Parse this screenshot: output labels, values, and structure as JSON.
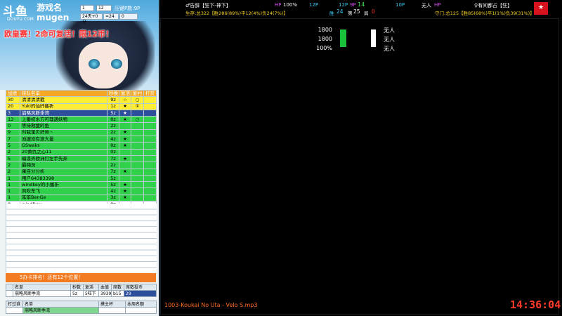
{
  "left_panel": {
    "logo": "斗鱼",
    "logo_sub": "DOUYU.COM",
    "game_name": "游戏名",
    "game_name_en": "mugen",
    "selects": [
      "1",
      "12"
    ],
    "controls_label": "压键P数:9P",
    "mini_fields": [
      "24天+0分",
      "=24",
      "0"
    ],
    "promo": "欧皇赛！2命可复活！限12币！",
    "table_headers": [
      "战绩",
      "排队名单",
      "秒换",
      "复活",
      "复约",
      "打赏"
    ],
    "rows": [
      {
        "c": [
          "30",
          "清清清清戳",
          "9z",
          "☆",
          "○",
          ""
        ],
        "style": "yellow"
      },
      {
        "c": [
          "20",
          "Yuki的灿奸播祈",
          "1z",
          "★",
          "①",
          ""
        ],
        "style": "yellow"
      },
      {
        "c": [
          "3",
          "崩略风断季湾",
          "5z",
          "★",
          "",
          ""
        ],
        "style": "blue"
      },
      {
        "c": [
          "13",
          "上番初水方可理遇妖物",
          "0z",
          "★",
          "○",
          ""
        ],
        "style": "green"
      },
      {
        "c": [
          "0",
          "等待救援的鱼",
          "2z",
          "",
          "",
          ""
        ],
        "style": "green"
      },
      {
        "c": [
          "9",
          "时我宝贝好帅丶",
          "2z",
          "★",
          "",
          ""
        ],
        "style": "green"
      },
      {
        "c": [
          "7",
          "池塘没有滚大量",
          "4z",
          "★",
          "",
          ""
        ],
        "style": "green"
      },
      {
        "c": [
          "5",
          "GSwaks",
          "0z",
          "★",
          "",
          ""
        ],
        "style": "green"
      },
      {
        "c": [
          "2",
          "20黄仇之心11",
          "0z",
          "",
          "",
          ""
        ],
        "style": "green"
      },
      {
        "c": [
          "5",
          "编谍弄欧洲打左手先弃",
          "7z",
          "★",
          "",
          ""
        ],
        "style": "green"
      },
      {
        "c": [
          "2",
          "最嗨员",
          "2z",
          "",
          "",
          ""
        ],
        "style": "green"
      },
      {
        "c": [
          "2",
          "果自分分析",
          "7z",
          "★",
          "",
          ""
        ],
        "style": "green"
      },
      {
        "c": [
          "1",
          "用户64383398",
          "5z",
          "",
          "",
          ""
        ],
        "style": "green"
      },
      {
        "c": [
          "1",
          "windkey的小播祈",
          "5z",
          "★",
          "",
          ""
        ],
        "style": "green"
      },
      {
        "c": [
          "1",
          "风吹东飞",
          "4z",
          "★",
          "",
          ""
        ],
        "style": "green"
      },
      {
        "c": [
          "1",
          "笨笨BenGe",
          "3z",
          "★",
          "",
          ""
        ],
        "style": "green"
      },
      {
        "c": [
          "0",
          "windlkey",
          "8z",
          "",
          "",
          ""
        ],
        "style": "white"
      },
      {
        "c": [
          "0",
          "铁血骑冥",
          "3z",
          "",
          "①",
          ""
        ],
        "style": "white"
      }
    ],
    "orange_bar": "5办卡排名！还有12个位置！",
    "info_headers": [
      "名单",
      "秒数",
      "复活",
      "血值",
      "席数",
      "席数投币"
    ],
    "info_values": [
      "崩略风断季湾",
      "5z",
      "5旺下",
      "3939",
      "b15",
      "29"
    ],
    "footer_headers": [
      "打过谁",
      "名单",
      "摸主杯",
      "本周名额"
    ],
    "footer_values": [
      "",
      "崩略风断季湾",
      "",
      ""
    ]
  },
  "top_hud": {
    "p1_name": "♂告辞【狂下-神下】",
    "hp_label": "HP",
    "p1_hp": "100%",
    "p1_power": "12P",
    "center_p": "12P",
    "center_hp": "9P",
    "center_num": "14",
    "p2_power": "10P",
    "p2_name": "无人",
    "p2_hp_label": "HP",
    "p3_name": "♀有间都占【狂】",
    "p1_stats": "生存:总322【胜286(89%)平12(4%)负24(7%)】",
    "center_stats_a": "胜",
    "center_stats_win": "24",
    "center_stats_b": "第",
    "center_stats_round": "25",
    "center_stats_c": "局",
    "center_stats_lose": "0",
    "p3_stats": "守门:总125【胜85(68%)平1(1%)负39(31%)】",
    "flag_char": "★"
  },
  "game_area": {
    "stat1": "1800",
    "stat2": "1800",
    "stat3": "100%",
    "right_labels": [
      "无人",
      "无人",
      "无人"
    ]
  },
  "music": "1003-Koukai No Uta - Velo S.mp3",
  "clock": "14:36:04"
}
